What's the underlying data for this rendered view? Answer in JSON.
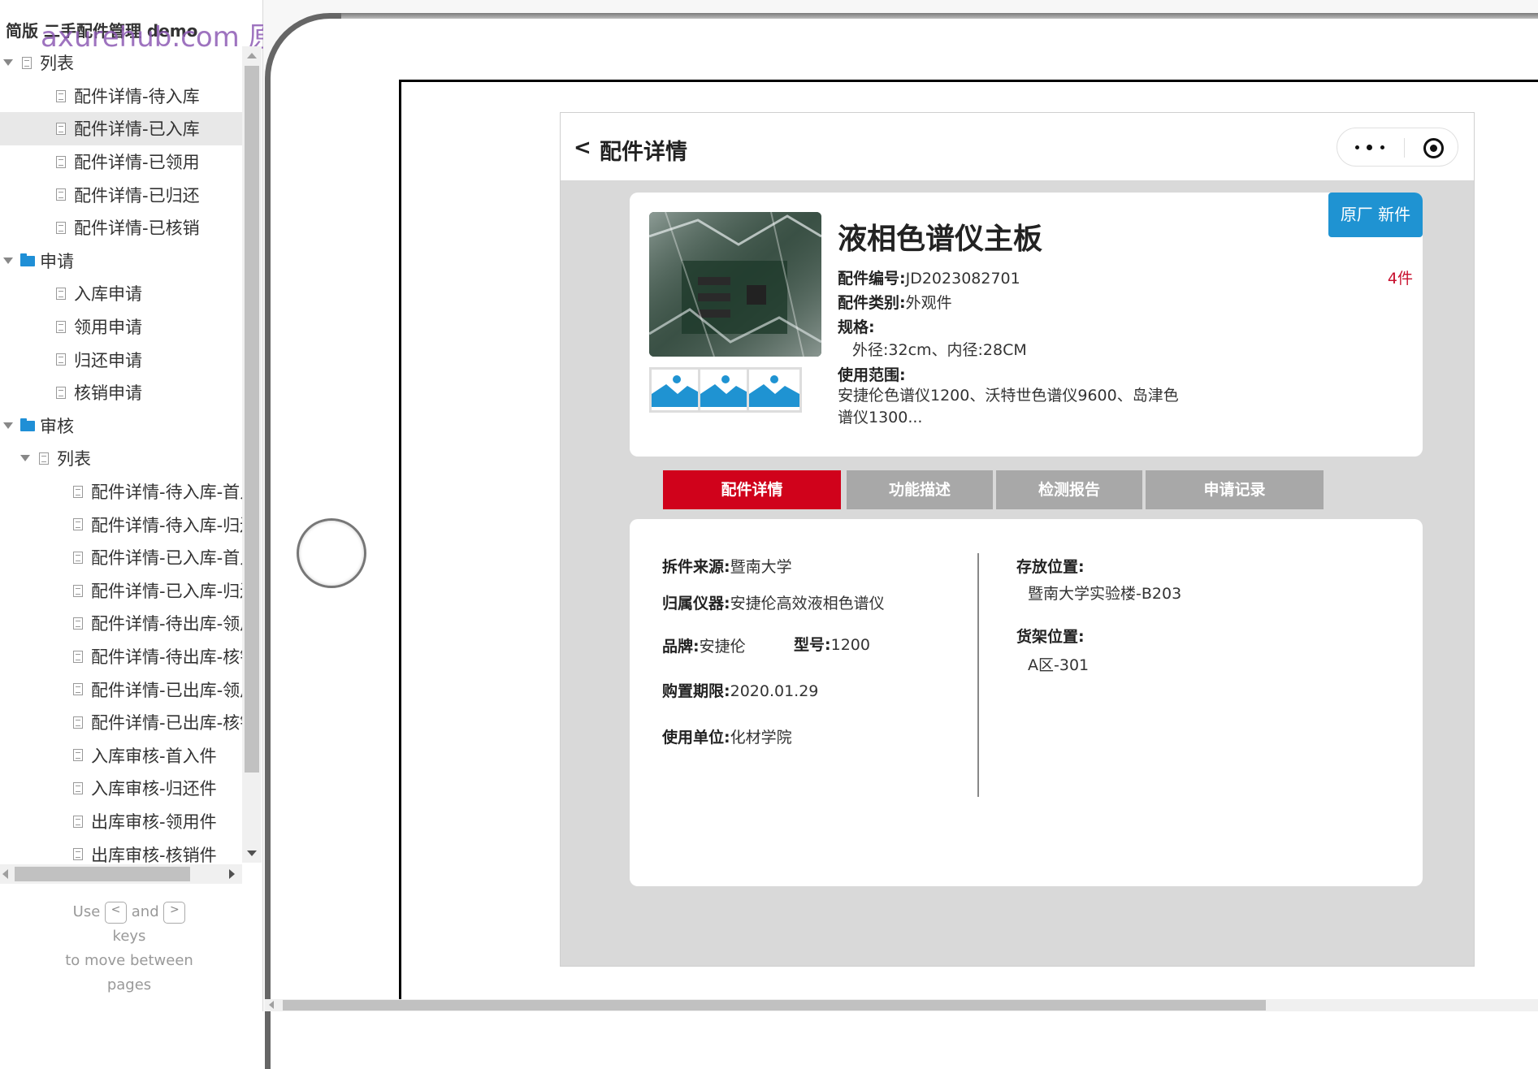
{
  "sidebar": {
    "project_title": "简版 二手配件管理 demo",
    "watermark": "axurehub.com 原型资源站",
    "tree": [
      {
        "label": "列表",
        "kind": "page",
        "level": 0,
        "expand": true
      },
      {
        "label": "配件详情-待入库",
        "kind": "page",
        "level": 1
      },
      {
        "label": "配件详情-已入库",
        "kind": "page",
        "level": 1,
        "selected": true
      },
      {
        "label": "配件详情-已领用",
        "kind": "page",
        "level": 1
      },
      {
        "label": "配件详情-已归还",
        "kind": "page",
        "level": 1
      },
      {
        "label": "配件详情-已核销",
        "kind": "page",
        "level": 1
      },
      {
        "label": "申请",
        "kind": "folder",
        "level": 0,
        "expand": true
      },
      {
        "label": "入库申请",
        "kind": "page",
        "level": 1
      },
      {
        "label": "领用申请",
        "kind": "page",
        "level": 1
      },
      {
        "label": "归还申请",
        "kind": "page",
        "level": 1
      },
      {
        "label": "核销申请",
        "kind": "page",
        "level": 1
      },
      {
        "label": "审核",
        "kind": "folder",
        "level": 0,
        "expand": true
      },
      {
        "label": "列表",
        "kind": "page",
        "level": 1,
        "expand": true
      },
      {
        "label": "配件详情-待入库-首入件",
        "kind": "page",
        "level": 2
      },
      {
        "label": "配件详情-待入库-归还件",
        "kind": "page",
        "level": 2
      },
      {
        "label": "配件详情-已入库-首入件",
        "kind": "page",
        "level": 2
      },
      {
        "label": "配件详情-已入库-归还件",
        "kind": "page",
        "level": 2
      },
      {
        "label": "配件详情-待出库-领用件",
        "kind": "page",
        "level": 2
      },
      {
        "label": "配件详情-待出库-核销件",
        "kind": "page",
        "level": 2
      },
      {
        "label": "配件详情-已出库-领用件",
        "kind": "page",
        "level": 2
      },
      {
        "label": "配件详情-已出库-核销件",
        "kind": "page",
        "level": 2
      },
      {
        "label": "入库审核-首入件",
        "kind": "page",
        "level": 2
      },
      {
        "label": "入库审核-归还件",
        "kind": "page",
        "level": 2
      },
      {
        "label": "出库审核-领用件",
        "kind": "page",
        "level": 2
      },
      {
        "label": "出库审核-核销件",
        "kind": "page",
        "level": 2
      }
    ],
    "help": {
      "use": "Use",
      "and": "and",
      "key_prev": "<",
      "key_next": ">",
      "keys": "keys",
      "line3": "to move between",
      "line4": "pages"
    }
  },
  "app": {
    "back": "<",
    "title": "配件详情",
    "tag": "原厂 新件",
    "product_name": "液相色谱仪主板",
    "code_label": "配件编号:",
    "code_value": "JD2023082701",
    "category_label": "配件类别:",
    "category_value": "外观件",
    "spec_label": "规格:",
    "spec_value": "外径:32cm、内径:28CM",
    "range_label": "使用范围:",
    "range_value": "安捷伦色谱仪1200、沃特世色谱仪9600、岛津色谱仪1300...",
    "quantity": "4件",
    "tabs": [
      "配件详情",
      "功能描述",
      "检测报告",
      "申请记录"
    ],
    "active_tab": 0,
    "detail": {
      "source_label": "拆件来源:",
      "source_value": "暨南大学",
      "instrument_label": "归属仪器:",
      "instrument_value": "安捷伦高效液相色谱仪",
      "brand_label": "品牌:",
      "brand_value": "安捷伦",
      "model_label": "型号:",
      "model_value": "1200",
      "purchase_label": "购置期限:",
      "purchase_value": "2020.01.29",
      "unit_label": "使用单位:",
      "unit_value": "化材学院",
      "storage_label": "存放位置:",
      "storage_value": "暨南大学实验楼-B203",
      "shelf_label": "货架位置:",
      "shelf_value": "A区-301"
    }
  },
  "colors": {
    "accent_red": "#d0021b",
    "tag_blue": "#1f93d2",
    "qty_red": "#c8102e",
    "tab_gray": "#a8a8a8",
    "folder_blue": "#1f8fd6"
  },
  "icons": [
    "tree-expand-icon",
    "page-icon",
    "folder-icon",
    "more-dots-icon",
    "target-icon",
    "image-placeholder-icon"
  ]
}
